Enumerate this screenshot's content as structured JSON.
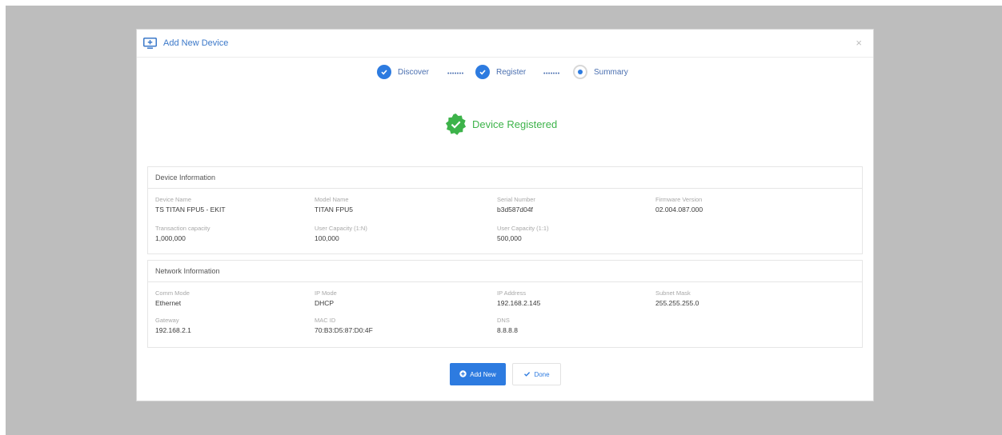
{
  "modal": {
    "title": "Add New Device",
    "close_icon": "×"
  },
  "stepper": {
    "steps": [
      {
        "label": "Discover",
        "state": "done"
      },
      {
        "label": "Register",
        "state": "done"
      },
      {
        "label": "Summary",
        "state": "active"
      }
    ],
    "connector": "•••••••"
  },
  "status": {
    "text": "Device Registered",
    "color": "#3db34a"
  },
  "device_info": {
    "title": "Device Information",
    "fields": [
      {
        "label": "Device Name",
        "value": "TS TITAN FPU5 - EKIT"
      },
      {
        "label": "Model Name",
        "value": "TITAN FPU5"
      },
      {
        "label": "Serial Number",
        "value": "b3d587d04f"
      },
      {
        "label": "Firmware Version",
        "value": "02.004.087.000"
      },
      {
        "label": "Transaction capacity",
        "value": "1,000,000"
      },
      {
        "label": "User Capacity (1:N)",
        "value": "100,000"
      },
      {
        "label": "User Capacity (1:1)",
        "value": "500,000"
      }
    ]
  },
  "network_info": {
    "title": "Network Information",
    "fields": [
      {
        "label": "Comm Mode",
        "value": "Ethernet"
      },
      {
        "label": "IP Mode",
        "value": "DHCP"
      },
      {
        "label": "IP Address",
        "value": "192.168.2.145"
      },
      {
        "label": "Subnet Mask",
        "value": "255.255.255.0"
      },
      {
        "label": "Gateway",
        "value": "192.168.2.1"
      },
      {
        "label": "MAC ID",
        "value": "70:B3:D5:87:D0:4F"
      },
      {
        "label": "DNS",
        "value": "8.8.8.8"
      }
    ]
  },
  "buttons": {
    "add_new": "Add New",
    "done": "Done"
  },
  "colors": {
    "accent": "#2d7be0",
    "success": "#3db34a",
    "backdrop": "#bdbdbd"
  }
}
